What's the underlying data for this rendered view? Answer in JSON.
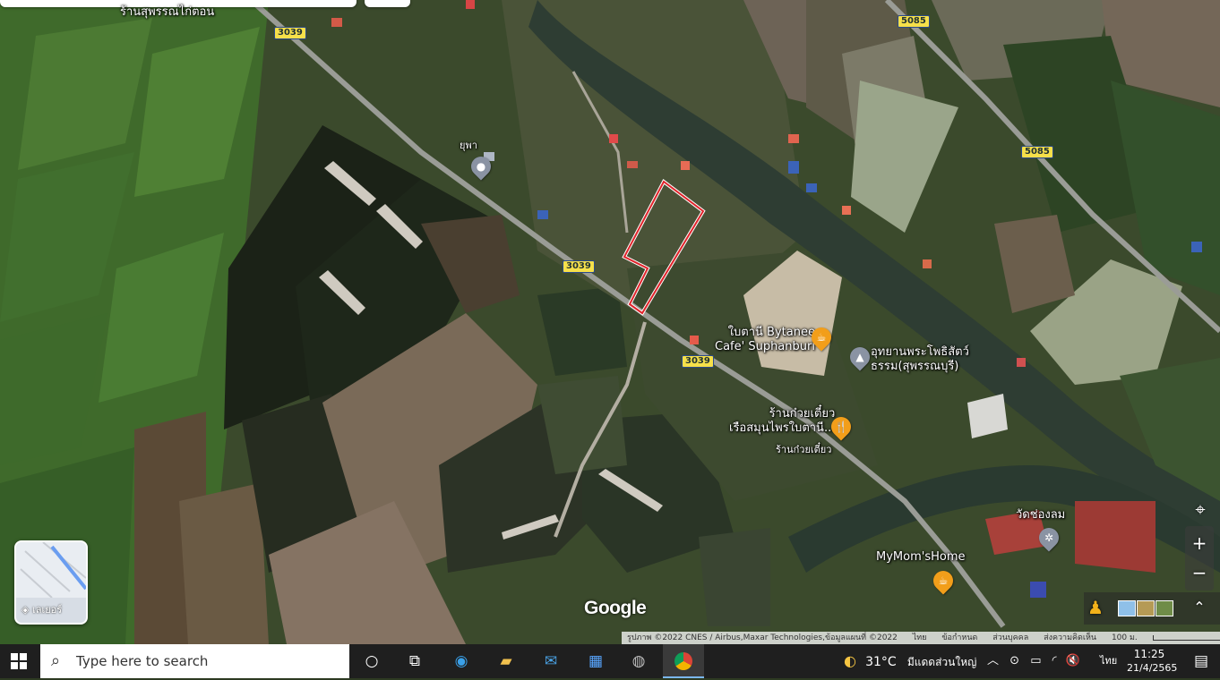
{
  "map": {
    "labels": {
      "shop_top": "ร้านสุพรรณไก่ตอน",
      "post": "ยุพา",
      "cafe": "ใบตานี Bytanee\nCafe' Suphanburi",
      "park": "อุทยานพระโพธิสัตว์\nธรรม(สุพรรณบุรี)",
      "noodle": "ร้านก๋วยเตี๋ยว\nเรือสมุนไพรใบตานี...",
      "noodle_sub": "ร้านก๋วยเตี๋ยว",
      "temple": "วัดช่องลม",
      "home": "MyMom'sHome"
    },
    "road_numbers": {
      "r1": "3039",
      "r2": "3039",
      "r3": "3039",
      "r4": "5085",
      "r5": "5085"
    },
    "layers_label": "เลเยอร์",
    "watermark": "Google",
    "attribution": {
      "imagery": "รูปภาพ ©2022 CNES / Airbus,Maxar Technologies,ข้อมูลแผนที่ ©2022",
      "lang": "ไทย",
      "terms": "ข้อกำหนด",
      "privacy": "ส่วนบุคคล",
      "feedback": "ส่งความคิดเห็น",
      "scale": "100 ม."
    },
    "controls": {
      "locate_icon": "crosshair-icon",
      "zoom_in": "+",
      "zoom_out": "−",
      "expand_icon": "chevron-up-icon",
      "pegman_icon": "pegman-icon"
    }
  },
  "taskbar": {
    "search_placeholder": "Type here to search",
    "weather_temp": "31°C",
    "weather_text": "มีแดดส่วนใหญ่",
    "lang": "ไทย",
    "time": "11:25",
    "date": "21/4/2565"
  },
  "colors": {
    "field_green": "#3f5a2a",
    "pond": "#1c2418",
    "parcel_outline": "#e0242b"
  }
}
